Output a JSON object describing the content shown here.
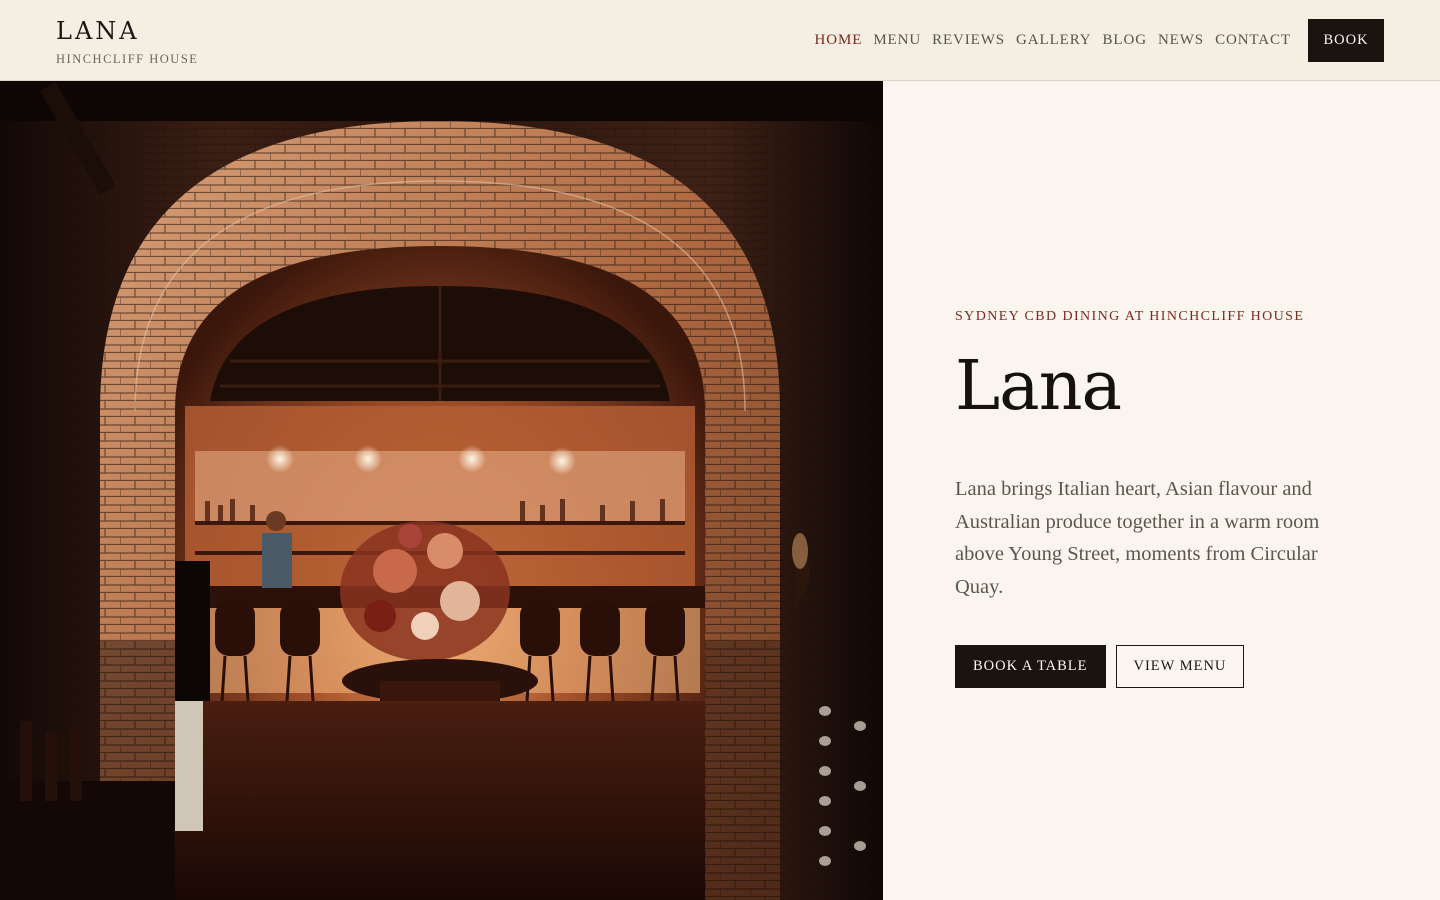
{
  "header": {
    "brand_name": "LANA",
    "brand_subtitle": "HINCHCLIFF HOUSE",
    "nav": [
      {
        "label": "HOME",
        "active": true
      },
      {
        "label": "MENU",
        "active": false
      },
      {
        "label": "REVIEWS",
        "active": false
      },
      {
        "label": "GALLERY",
        "active": false
      },
      {
        "label": "BLOG",
        "active": false
      },
      {
        "label": "NEWS",
        "active": false
      },
      {
        "label": "CONTACT",
        "active": false
      }
    ],
    "book_label": "BOOK"
  },
  "hero": {
    "eyebrow": "SYDNEY CBD DINING AT HINCHCLIFF HOUSE",
    "title": "Lana",
    "body": "Lana brings Italian heart, Asian flavour and Australian produce together in a warm room above Young Street, moments from Circular Quay.",
    "primary_cta": "BOOK A TABLE",
    "secondary_cta": "VIEW MENU"
  },
  "colors": {
    "header_bg": "#f5eee3",
    "page_bg": "#faf6ef",
    "accent": "#7a2a20",
    "button_dark": "#1a1410"
  }
}
